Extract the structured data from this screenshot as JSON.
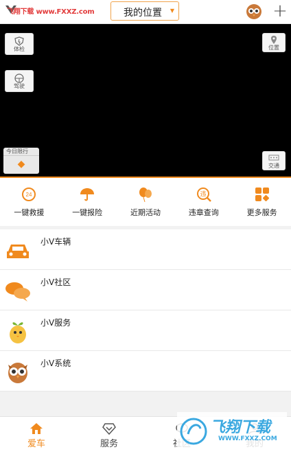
{
  "topbar": {
    "watermark": "飞翔下载 www.FXXZ.com",
    "location_label": "我的位置",
    "add_label": "+"
  },
  "map": {
    "checkup_label": "体检",
    "drive_label": "驾驶",
    "position_label": "位置",
    "traffic_label": "交通",
    "today_restriction_label": "今日限行"
  },
  "actions": [
    {
      "label": "一键救援",
      "icon": "rescue-icon"
    },
    {
      "label": "一键报险",
      "icon": "umbrella-icon"
    },
    {
      "label": "近期活动",
      "icon": "balloon-icon"
    },
    {
      "label": "违章查询",
      "icon": "violation-search-icon"
    },
    {
      "label": "更多服务",
      "icon": "grid-icon"
    }
  ],
  "list": [
    {
      "title": "小V车辆",
      "icon": "car-icon"
    },
    {
      "title": "小V社区",
      "icon": "chat-bubbles-icon"
    },
    {
      "title": "小V服务",
      "icon": "sprout-mascot-icon"
    },
    {
      "title": "小V系统",
      "icon": "owl-icon"
    }
  ],
  "bottomnav": [
    {
      "label": "爱车",
      "active": true
    },
    {
      "label": "服务",
      "active": false
    },
    {
      "label": "社区",
      "active": false
    },
    {
      "label": "我的",
      "active": false
    }
  ],
  "watermark_bottom": {
    "brand": "飞翔下载",
    "url": "WWW.FXXZ.COM"
  },
  "colors": {
    "accent": "#f08a1e",
    "map_bg": "#000000",
    "watermark_blue": "#3aa8e0",
    "watermark_red": "#e23b3b"
  }
}
